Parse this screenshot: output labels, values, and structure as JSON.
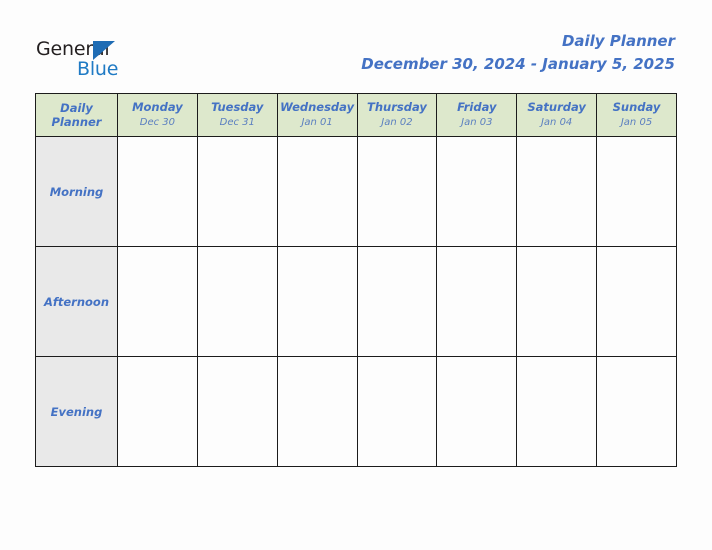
{
  "brand": {
    "name_part1": "General",
    "name_part2": "Blue",
    "triangle_color": "#1f6cb4",
    "part1_color": "#231f20",
    "part2_color": "#1f7ac4"
  },
  "header": {
    "title": "Daily Planner",
    "date_range": "December 30, 2024 - January 5, 2025",
    "title_color": "#4472c4"
  },
  "table": {
    "corner_label": "Daily Planner",
    "header_bg": "#dde8cc",
    "slot_bg": "#e9e9e9",
    "border_color": "#1c1c1c",
    "columns": [
      {
        "day": "Monday",
        "date": "Dec 30"
      },
      {
        "day": "Tuesday",
        "date": "Dec 31"
      },
      {
        "day": "Wednesday",
        "date": "Jan 01"
      },
      {
        "day": "Thursday",
        "date": "Jan 02"
      },
      {
        "day": "Friday",
        "date": "Jan 03"
      },
      {
        "day": "Saturday",
        "date": "Jan 04"
      },
      {
        "day": "Sunday",
        "date": "Jan 05"
      }
    ],
    "rows": [
      {
        "label": "Morning",
        "entries": [
          "",
          "",
          "",
          "",
          "",
          "",
          ""
        ]
      },
      {
        "label": "Afternoon",
        "entries": [
          "",
          "",
          "",
          "",
          "",
          "",
          ""
        ]
      },
      {
        "label": "Evening",
        "entries": [
          "",
          "",
          "",
          "",
          "",
          "",
          ""
        ]
      }
    ]
  }
}
